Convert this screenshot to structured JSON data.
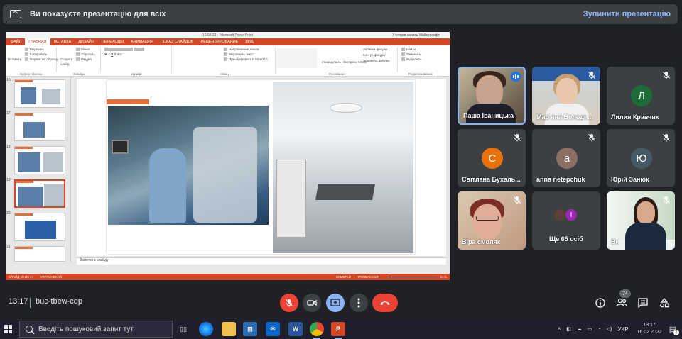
{
  "presenting_bar": {
    "message": "Ви показуєте презентацію для всіх",
    "stop_label": "Зупинити презентацію"
  },
  "ppt": {
    "window_title": "16.02.22 - Microsoft PowerPoint",
    "account": "Учетная запись Майкрософт",
    "tabs": [
      "ФАЙЛ",
      "ГЛАВНАЯ",
      "ВСТАВКА",
      "ДИЗАЙН",
      "ПЕРЕХОДЫ",
      "АНИМАЦИЯ",
      "ПОКАЗ СЛАЙДОВ",
      "РЕЦЕНЗИРОВАНИЕ",
      "ВИД"
    ],
    "ribbon": {
      "paste": "Вставить",
      "cut": "Вырезать",
      "copy": "Копировать",
      "format_painter": "Формат по образцу",
      "clipboard": "Буфер обмена",
      "new_slide": "Создать слайд",
      "layout": "Макет",
      "reset": "Сбросить",
      "section": "Раздел",
      "slides": "Слайды",
      "font": "Шрифт",
      "text_direction": "Направление текста",
      "align_text": "Выровнять текст",
      "smartart": "Преобразовать в SmartArt",
      "paragraph": "Абзац",
      "arrange": "Упорядочить",
      "quick_styles": "Экспресс-стили",
      "shape_fill": "Заливка фигуры",
      "shape_outline": "Контур фигуры",
      "shape_effects": "Эффекты фигуры",
      "drawing": "Рисование",
      "find": "Найти",
      "replace": "Заменить",
      "select": "Выделить",
      "editing": "Редактирование"
    },
    "thumb_numbers": [
      "16",
      "17",
      "18",
      "19",
      "20",
      "21"
    ],
    "notes_label": "Заметки к слайду",
    "status_left": "СЛАЙД 19 ИЗ 44",
    "status_lang": "УКРАИНСКИЙ",
    "status_notes": "ЗАМЕТКИ",
    "status_comments": "ПРИМЕЧАНИЯ",
    "zoom": "61%"
  },
  "participants": [
    {
      "name": "Паша Іваницька",
      "type": "video"
    },
    {
      "name": "Мар'яна Володи...",
      "type": "video"
    },
    {
      "name": "Лилия Кравчик",
      "type": "avatar",
      "initial": "Л",
      "color": "#1e6b3a"
    },
    {
      "name": "Світлана Бухаль...",
      "type": "avatar",
      "initial": "С",
      "color": "#e8710a"
    },
    {
      "name": "anna netepchuk",
      "type": "avatar",
      "initial": "a",
      "color": "#8d6e63"
    },
    {
      "name": "Юрій Занюк",
      "type": "avatar",
      "initial": "Ю",
      "color": "#455a64"
    },
    {
      "name": "Віра смоляк",
      "type": "video"
    },
    {
      "name": "Ще 65 осіб",
      "type": "more",
      "mini_initial": "I"
    },
    {
      "name": "Ви",
      "type": "video"
    }
  ],
  "meeting": {
    "time": "13:17",
    "code": "buc-tbew-cqp",
    "participant_count": "74"
  },
  "taskbar": {
    "search_placeholder": "Введіть пошуковий запит тут",
    "lang": "УКР",
    "time": "13:17",
    "date": "16.02.2022",
    "notif_count": "2"
  },
  "colors": {
    "meet_bg": "#202124",
    "tile_bg": "#3c4043",
    "accent_blue": "#8ab4f8",
    "end_red": "#ea4335",
    "ppt_orange": "#d24726"
  }
}
